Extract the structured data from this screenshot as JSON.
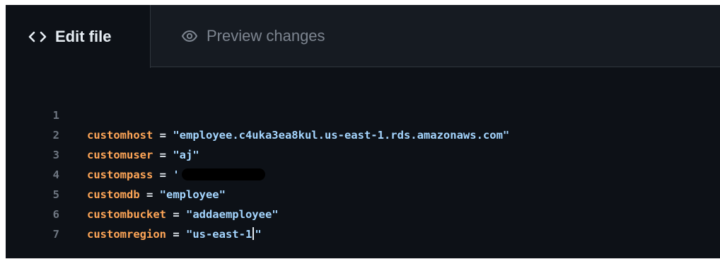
{
  "tabs": {
    "edit_label": "Edit file",
    "preview_label": "Preview changes"
  },
  "code": {
    "lines": [
      {
        "number": "1",
        "key": "customhost",
        "op": " = ",
        "value": "\"employee.c4uka3ea8kul.us-east-1.rds.amazonaws.com\""
      },
      {
        "number": "2",
        "key": "customuser",
        "op": " = ",
        "value": "\"aj\""
      },
      {
        "number": "3",
        "key": "custompass",
        "op": " = ",
        "value": "'"
      },
      {
        "number": "4",
        "key": "customdb",
        "op": " = ",
        "value": "\"employee\""
      },
      {
        "number": "5",
        "key": "custombucket",
        "op": " = ",
        "value": "\"addaemployee\""
      },
      {
        "number": "6",
        "key": "customregion",
        "op": " = ",
        "value": "\"us-east-1",
        "value_after_cursor": "\""
      },
      {
        "number": "7"
      }
    ]
  },
  "colors": {
    "editor_bg": "#0d1117",
    "tabbar_bg": "#161b22",
    "keyword": "#ffa657",
    "string": "#a5d6ff",
    "line_number": "#6e7681"
  }
}
